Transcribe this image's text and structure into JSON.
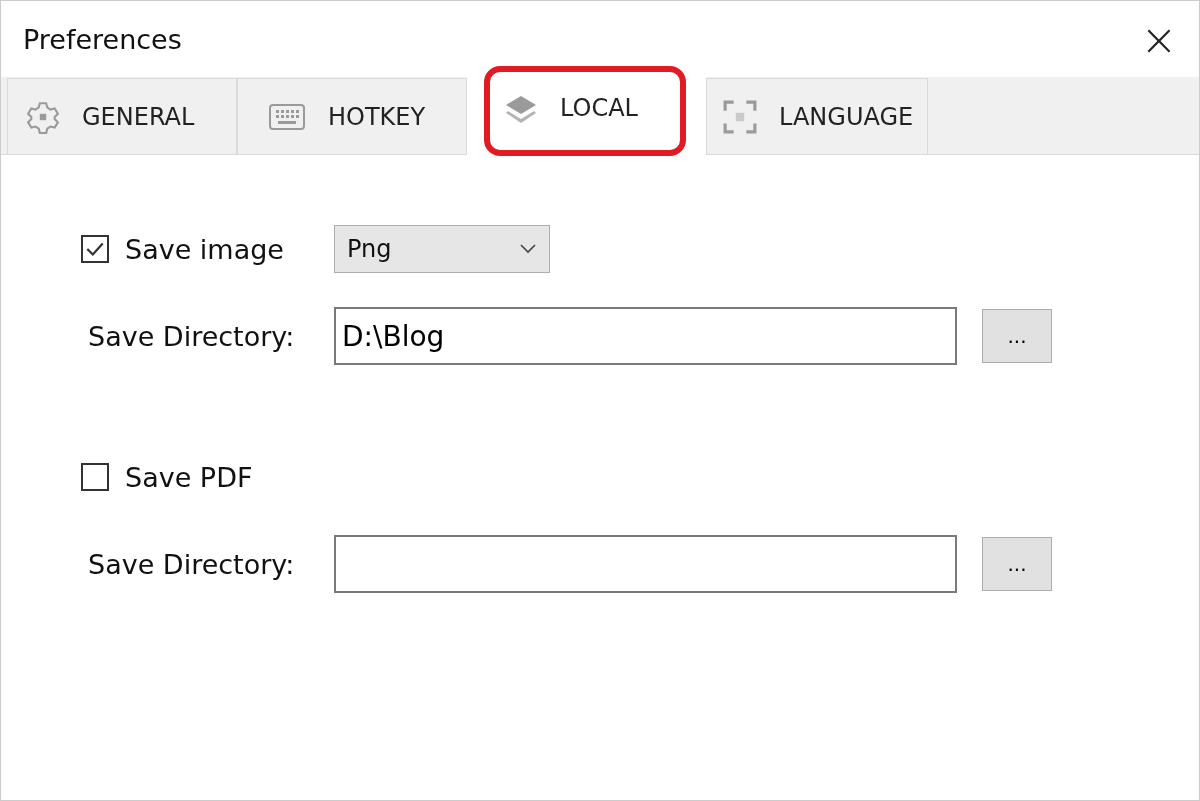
{
  "window": {
    "title": "Preferences",
    "close": "×"
  },
  "tabs": [
    {
      "label": "GENERAL",
      "selected": false
    },
    {
      "label": "HOTKEY",
      "selected": false
    },
    {
      "label": "LOCAL",
      "selected": true,
      "highlighted": true
    },
    {
      "label": "LANGUAGE",
      "selected": false
    }
  ],
  "sections": [
    {
      "checkbox_label": "Save image",
      "checked": true,
      "format": "Png",
      "directory_label": "Save Directory:",
      "directory_value": "D:\\Blog",
      "browse_label": "..."
    },
    {
      "checkbox_label": "Save PDF",
      "checked": false,
      "directory_label": "Save Directory:",
      "browse_label": "..."
    }
  ]
}
